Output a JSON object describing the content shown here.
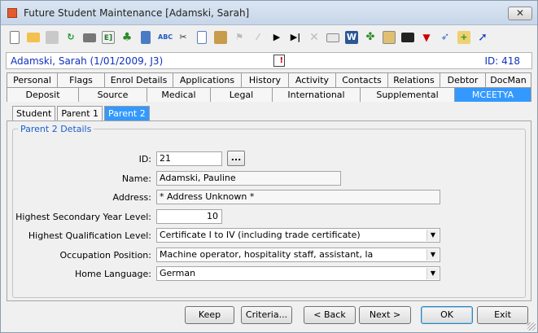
{
  "window": {
    "title": "Future Student Maintenance  [Adamski, Sarah]"
  },
  "toolbar": {
    "icons": [
      "new-doc-icon",
      "open-folder-icon",
      "save-icon",
      "refresh-icon",
      "print-icon",
      "edit-icon",
      "tree-icon",
      "calculator-icon",
      "spellcheck-icon",
      "cut-icon",
      "copy-icon",
      "paste-icon",
      "flag-icon",
      "line-icon",
      "play-icon",
      "skip-icon",
      "delete-icon",
      "email-icon",
      "word-icon",
      "network-icon",
      "report-icon",
      "clapper-icon",
      "inbox-icon",
      "tag-icon",
      "add-note-icon",
      "pen-icon"
    ]
  },
  "header": {
    "student": "Adamski, Sarah (1/01/2009, J3)",
    "id": "ID: 418"
  },
  "tabs_row1": [
    "Personal",
    "Flags",
    "Enrol Details",
    "Applications",
    "History",
    "Activity",
    "Contacts",
    "Relations",
    "Debtor",
    "DocMan"
  ],
  "tabs_row2": [
    "Deposit",
    "Source",
    "Medical",
    "Legal",
    "International",
    "Supplemental",
    "MCEETYA"
  ],
  "active_tab": "MCEETYA",
  "subtabs": [
    "Student",
    "Parent 1",
    "Parent 2"
  ],
  "active_subtab": "Parent 2",
  "form": {
    "group_title": "Parent 2 Details",
    "id_label": "ID:",
    "id_value": "21",
    "lookup_button": "...",
    "name_label": "Name:",
    "name_value": "Adamski, Pauline",
    "address_label": "Address:",
    "address_value": "* Address Unknown *",
    "secondary_label": "Highest Secondary Year Level:",
    "secondary_value": "10",
    "qualification_label": "Highest Qualification Level:",
    "qualification_value": "Certificate I to IV (including trade certificate)",
    "occupation_label": "Occupation Position:",
    "occupation_value": "Machine operator, hospitality staff, assistant, la",
    "language_label": "Home Language:",
    "language_value": "German"
  },
  "buttons": {
    "keep": "Keep",
    "criteria": "Criteria...",
    "back": "< Back",
    "next": "Next >",
    "ok": "OK",
    "exit": "Exit"
  },
  "colors": {
    "accent": "#3399ff",
    "header_text": "#1030c0",
    "group_title": "#1a5fc8"
  }
}
